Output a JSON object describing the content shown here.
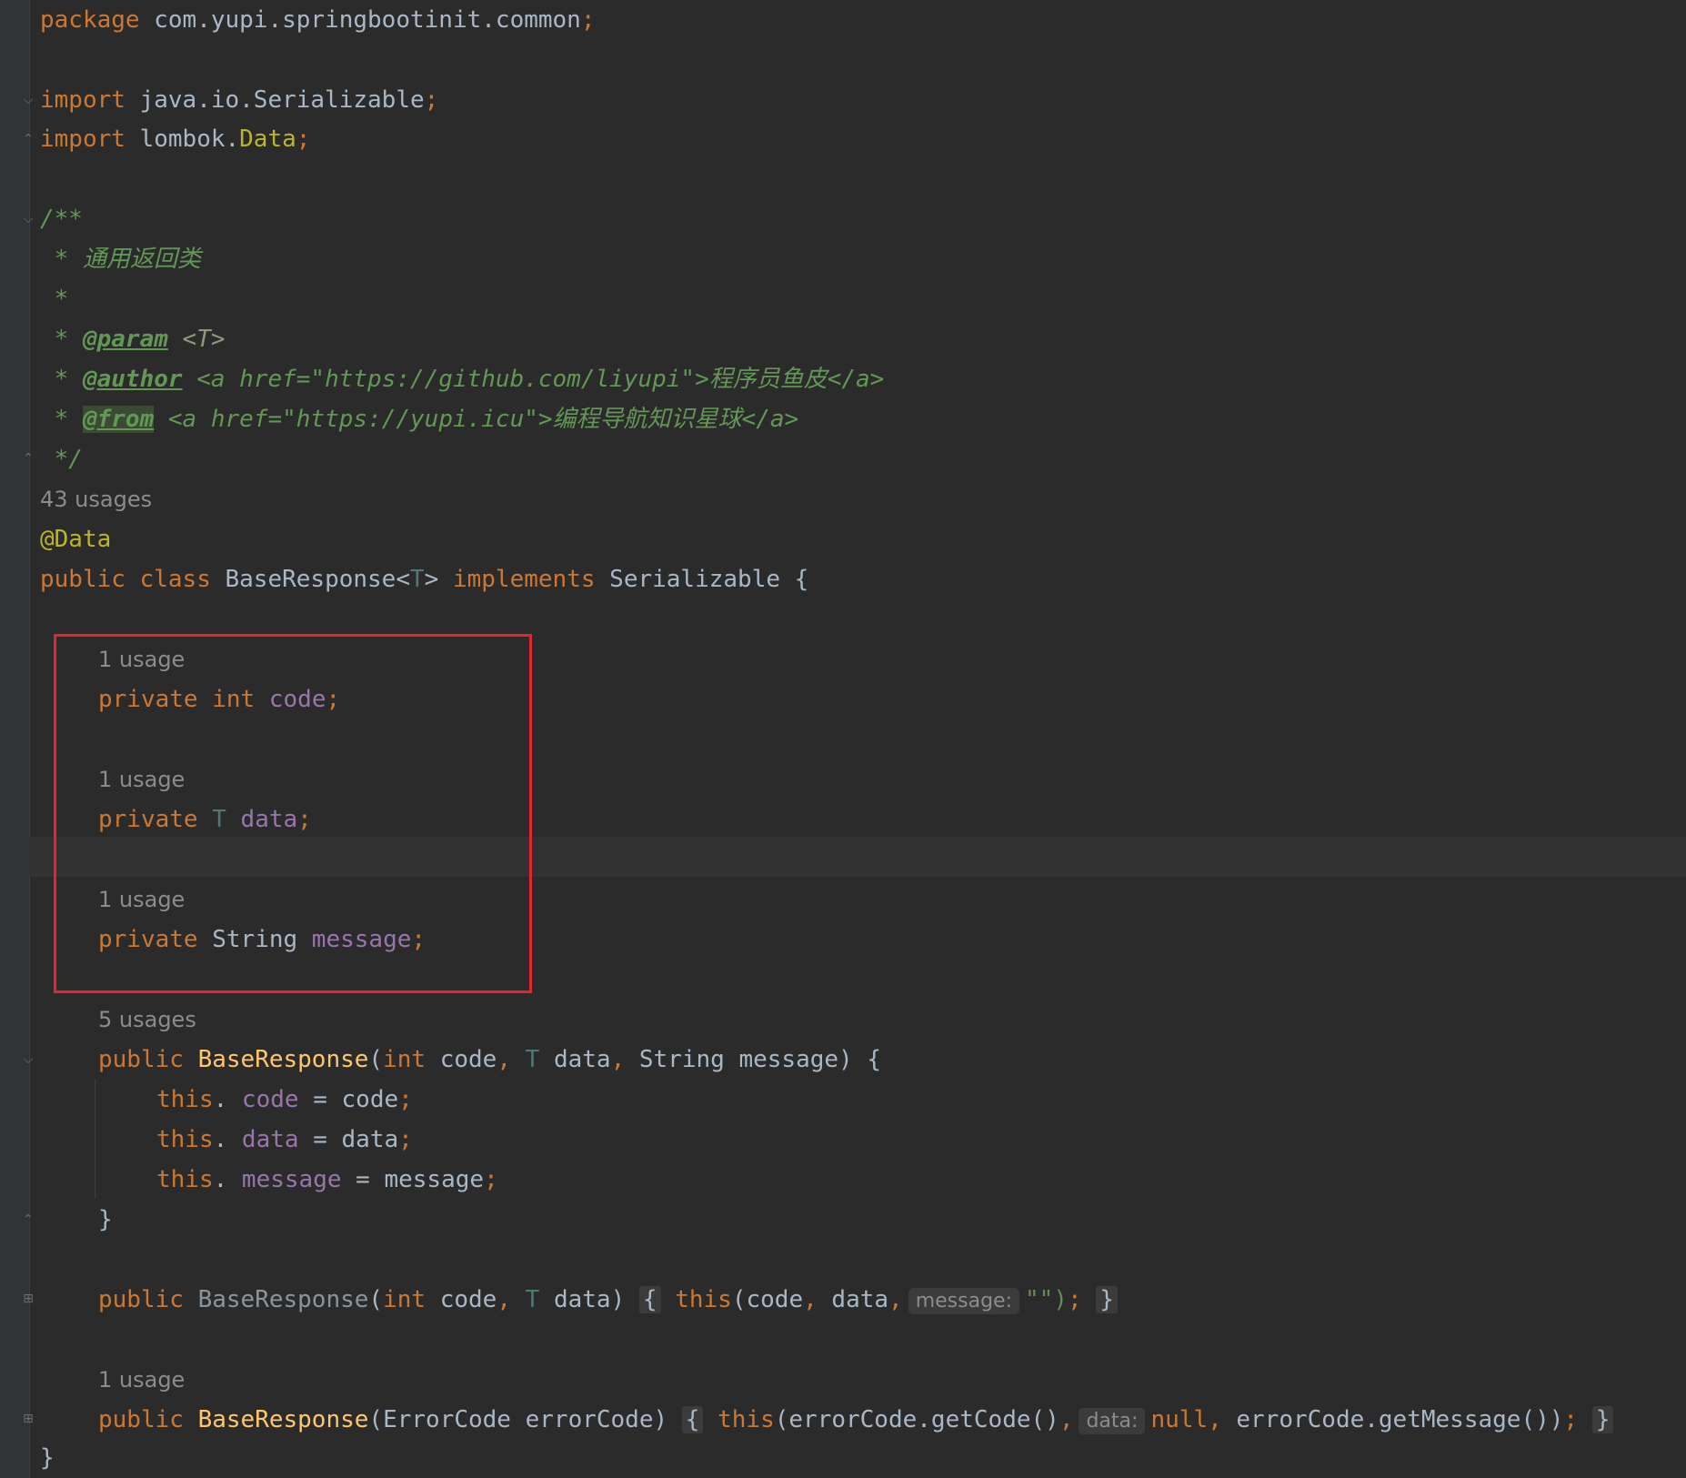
{
  "code": {
    "package_kw": "package",
    "package_name": " com.yupi.springbootinit.common",
    "semicolon": ";",
    "import_kw": "import",
    "import1": " java.io.Serializable",
    "import2_pre": " lombok.",
    "import2_cls": "Data",
    "doc_open": "/**",
    "doc_line1": " * 通用返回类",
    "doc_line2": " *",
    "doc_star": " * ",
    "param_tag": "@param",
    "param_val": " <T>",
    "author_tag": "@author",
    "author_val": " <a href=\"https://github.com/liyupi\">程序员鱼皮</a>",
    "from_tag": "@from",
    "from_val": " <a href=\"https://yupi.icu\">编程导航知识星球</a>",
    "doc_close": " */",
    "class_usages": "43 usages",
    "annotation": "@Data",
    "public_kw": "public",
    "class_kw": " class",
    "class_name": " BaseResponse<",
    "type_param": "T",
    "class_rest": "> ",
    "implements_kw": "implements",
    "class_iface": " Serializable {",
    "usage_1": "1 usage",
    "private_kw": "private",
    "int_kw": " int",
    "field_code": " code",
    "field_data": " data",
    "string_type": " String",
    "field_message": " message",
    "ctor_usages": "5 usages",
    "ctor_name": "BaseResponse",
    "ctor1_params_a": "(",
    "ctor1_int": "int",
    "ctor1_code": " code",
    "comma": ",",
    "ctor1_T": " T",
    "ctor1_data": " data",
    "ctor1_str": " String message) {",
    "this_kw": "this",
    "dot": ".",
    "assign_code": " = code",
    "assign_data": " = data",
    "assign_message": " = message",
    "close_brace": "}",
    "ctor2_rest": ") ",
    "open_brace": "{",
    "this_call_open": "(code",
    "ctor2_data": " data",
    "hint_message": "message:",
    "empty_str": "\"\")",
    "ctor3_params": "(ErrorCode errorCode) ",
    "ctor3_call": "(errorCode.getCode()",
    "hint_data": "data:",
    "null_kw": "null",
    "ctor3_tail": " errorCode.getMessage())",
    "class_close": "}"
  }
}
